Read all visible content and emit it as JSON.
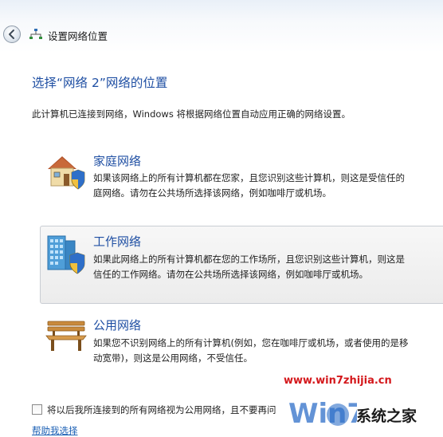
{
  "window": {
    "title": "设置网络位置"
  },
  "main": {
    "heading": "选择“网络  2”网络的位置",
    "description": "此计算机已连接到网络，Windows 将根据网络位置自动应用正确的网络设置。"
  },
  "options": [
    {
      "icon": "house-shield-icon",
      "title": "家庭网络",
      "desc_line1": "如果该网络上的所有计算机都在您家，且您识别这些计算机，则这是受信任的",
      "desc_line2": "庭网络。请勿在公共场所选择该网络，例如咖啡厅或机场。"
    },
    {
      "icon": "office-building-shield-icon",
      "title": "工作网络",
      "desc_line1": "如果此网络上的所有计算机都在您的工作场所，且您识别这些计算机，则这是",
      "desc_line2": "信任的工作网络。请勿在公共场所选择该网络，例如咖啡厅或机场。"
    },
    {
      "icon": "park-bench-icon",
      "title": "公用网络",
      "desc_line1": "如果您不识别网络上的所有计算机(例如，您在咖啡厅或机场，或者使用的是移",
      "desc_line2": "动宽带)，则这是公用网络，不受信任。"
    }
  ],
  "footer": {
    "checkbox_label": "将以后我所连接到的所有网络视为公用网络，且不要再问",
    "checkbox_checked": false,
    "help_link": "帮助我选择"
  },
  "watermark": {
    "url": "www.win7zhijia.cn",
    "site_name": "系统之家",
    "logo_text": "Win7"
  },
  "colors": {
    "heading_blue": "#1f4fa3",
    "link_blue": "#1a5fb4",
    "watermark_red": "#d4181c"
  }
}
